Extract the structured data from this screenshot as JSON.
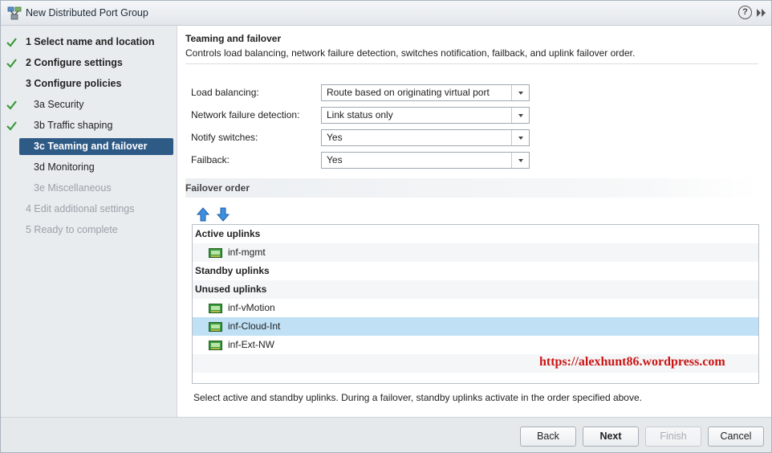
{
  "window": {
    "title": "New Distributed Port Group",
    "help_label": "?"
  },
  "sidebar": {
    "steps": [
      {
        "label": "1  Select name and location",
        "completed": true,
        "state": "done"
      },
      {
        "label": "2  Configure settings",
        "completed": true,
        "state": "done"
      },
      {
        "label": "3  Configure policies",
        "completed": false,
        "state": "current-parent"
      },
      {
        "label": "3a  Security",
        "completed": true,
        "state": "done"
      },
      {
        "label": "3b  Traffic shaping",
        "completed": true,
        "state": "done"
      },
      {
        "label": "3c  Teaming and failover",
        "completed": false,
        "state": "active"
      },
      {
        "label": "3d  Monitoring",
        "completed": false,
        "state": "pending"
      },
      {
        "label": "3e  Miscellaneous",
        "completed": false,
        "state": "disabled"
      },
      {
        "label": "4  Edit additional settings",
        "completed": false,
        "state": "disabled"
      },
      {
        "label": "5  Ready to complete",
        "completed": false,
        "state": "disabled"
      }
    ]
  },
  "section": {
    "title": "Teaming and failover",
    "description": "Controls load balancing, network failure detection, switches notification, failback, and uplink failover order."
  },
  "form": {
    "load_balancing": {
      "label": "Load balancing:",
      "value": "Route based on originating virtual port"
    },
    "failure_detection": {
      "label": "Network failure detection:",
      "value": "Link status only"
    },
    "notify_switches": {
      "label": "Notify switches:",
      "value": "Yes"
    },
    "failback": {
      "label": "Failback:",
      "value": "Yes"
    }
  },
  "failover": {
    "title": "Failover order",
    "move_up_icon": "arrow-up-icon",
    "move_down_icon": "arrow-down-icon",
    "groups": {
      "active": "Active uplinks",
      "standby": "Standby uplinks",
      "unused": "Unused uplinks"
    },
    "active_uplinks": [
      "inf-mgmt"
    ],
    "unused_uplinks": [
      "inf-vMotion",
      "inf-Cloud-Int",
      "inf-Ext-NW"
    ],
    "selected": "inf-Cloud-Int",
    "hint": "Select active and standby uplinks. During a failover, standby uplinks activate in the order specified above."
  },
  "watermark": "https://alexhunt86.wordpress.com",
  "footer": {
    "back": "Back",
    "next": "Next",
    "finish": "Finish",
    "cancel": "Cancel"
  },
  "colors": {
    "active_step": "#2e5a86",
    "selected_row": "#bfe0f5",
    "check": "#3a9a3a",
    "watermark": "#cc1414"
  }
}
